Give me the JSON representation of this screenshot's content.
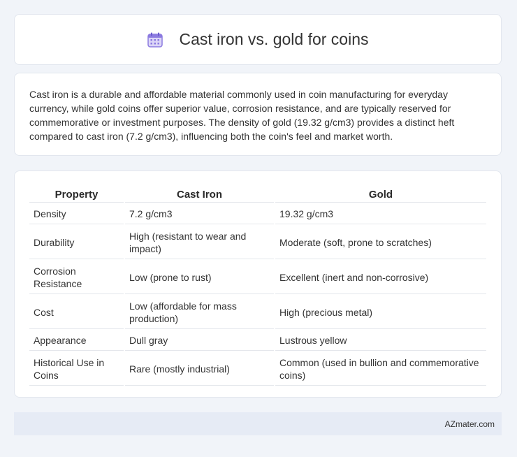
{
  "header": {
    "title": "Cast iron vs. gold for coins",
    "icon": "calendar-icon",
    "icon_color": "#8c7be0"
  },
  "intro": {
    "text": "Cast iron is a durable and affordable material commonly used in coin manufacturing for everyday currency, while gold coins offer superior value, corrosion resistance, and are typically reserved for commemorative or investment purposes. The density of gold (19.32 g/cm3) provides a distinct heft compared to cast iron (7.2 g/cm3), influencing both the coin's feel and market worth."
  },
  "table": {
    "headers": [
      "Property",
      "Cast Iron",
      "Gold"
    ],
    "rows": [
      [
        "Density",
        "7.2 g/cm3",
        "19.32 g/cm3"
      ],
      [
        "Durability",
        "High (resistant to wear and impact)",
        "Moderate (soft, prone to scratches)"
      ],
      [
        "Corrosion Resistance",
        "Low (prone to rust)",
        "Excellent (inert and non-corrosive)"
      ],
      [
        "Cost",
        "Low (affordable for mass production)",
        "High (precious metal)"
      ],
      [
        "Appearance",
        "Dull gray",
        "Lustrous yellow"
      ],
      [
        "Historical Use in Coins",
        "Rare (mostly industrial)",
        "Common (used in bullion and commemorative coins)"
      ]
    ]
  },
  "footer": {
    "site": "AZmater.com"
  }
}
